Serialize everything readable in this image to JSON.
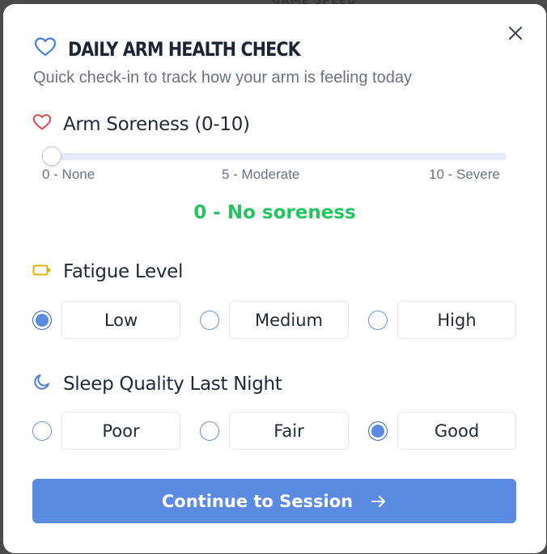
{
  "background": {
    "partial_text": "GAME SPEED"
  },
  "modal": {
    "title": "DAILY ARM HEALTH CHECK",
    "subtitle": "Quick check-in to track how your arm is feeling today",
    "close_icon": "close-icon",
    "title_icon": "heart-icon"
  },
  "soreness": {
    "label": "Arm Soreness (0-10)",
    "icon": "heart-icon",
    "min": 0,
    "max": 10,
    "value": 0,
    "scale_labels": [
      "0 - None",
      "5 - Moderate",
      "10 - Severe"
    ],
    "value_text": "0 - No soreness"
  },
  "fatigue": {
    "label": "Fatigue Level",
    "icon": "battery-icon",
    "options": [
      "Low",
      "Medium",
      "High"
    ],
    "selected": "Low"
  },
  "sleep": {
    "label": "Sleep Quality Last Night",
    "icon": "moon-icon",
    "options": [
      "Poor",
      "Fair",
      "Good"
    ],
    "selected": "Good"
  },
  "actions": {
    "continue_label": "Continue to Session",
    "continue_icon": "arrow-right-icon"
  },
  "colors": {
    "accent": "#5b8be0",
    "title_heart": "#4a7fd8",
    "soreness_heart": "#e5484d",
    "fatigue_icon": "#e0b100",
    "success": "#22c55e"
  }
}
